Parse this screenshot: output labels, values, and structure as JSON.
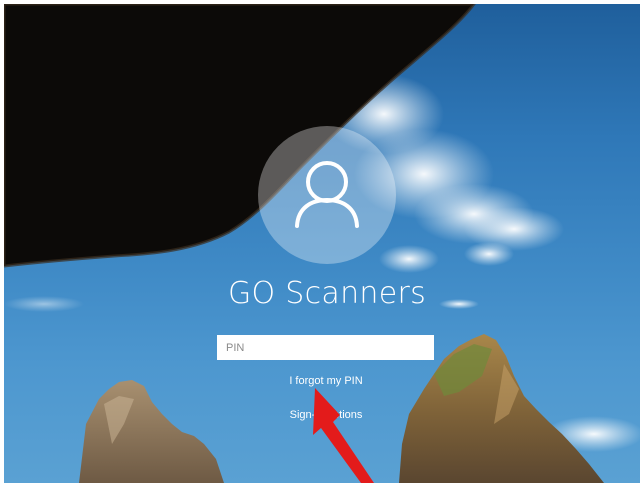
{
  "account": {
    "name": "GO Scanners"
  },
  "pin": {
    "placeholder": "PIN",
    "value": ""
  },
  "links": {
    "forgot_pin": "I forgot my PIN",
    "sign_in_options": "Sign-in options"
  },
  "icons": {
    "avatar": "user-icon"
  },
  "colors": {
    "annotation_arrow": "#e31b1b",
    "text": "#ffffff"
  }
}
